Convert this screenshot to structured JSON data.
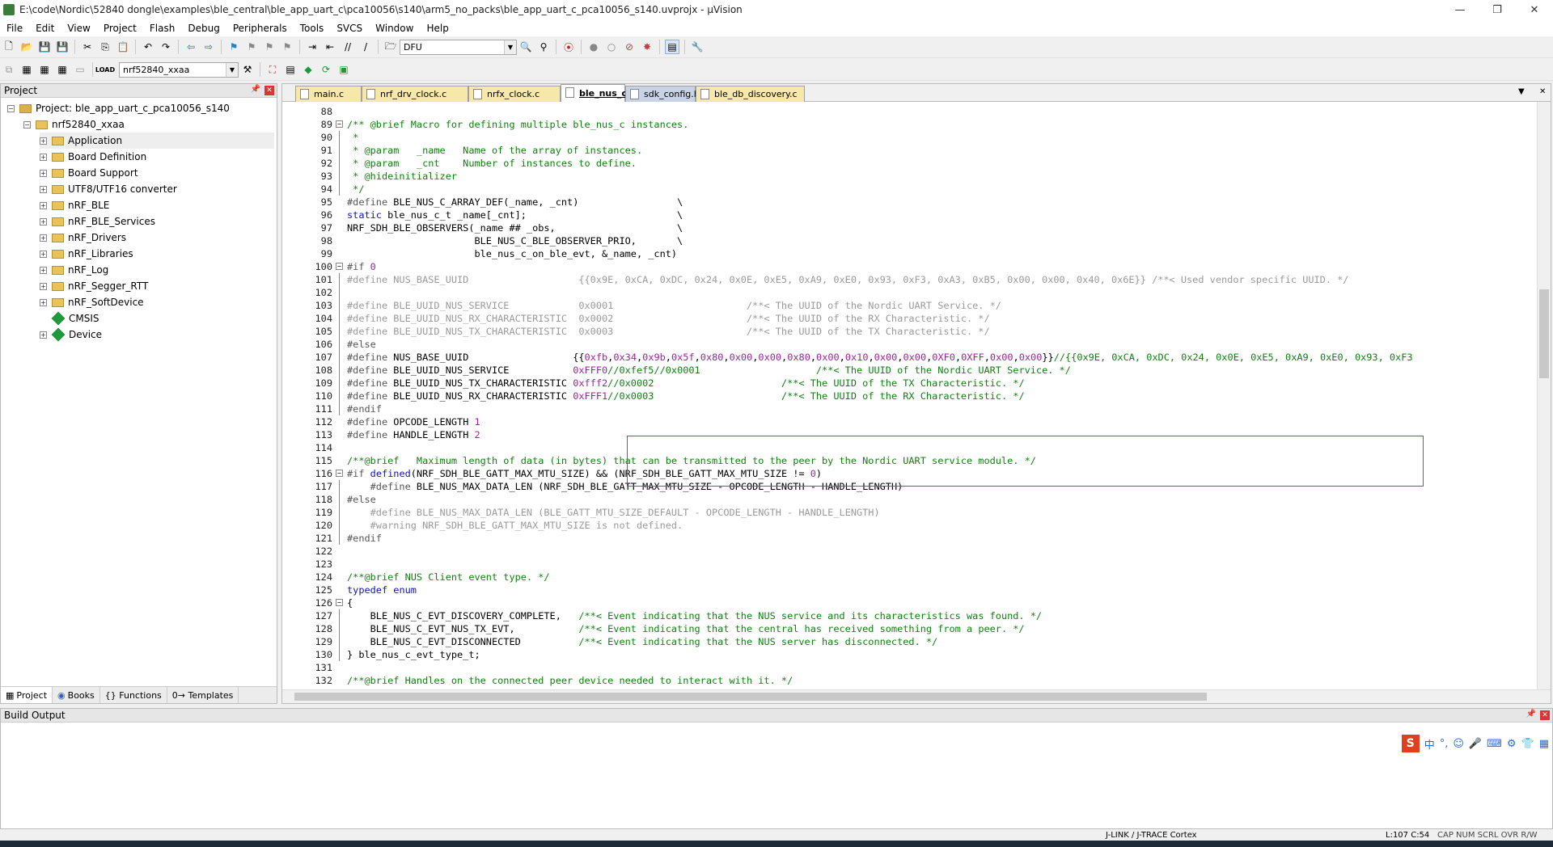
{
  "window": {
    "title": "E:\\code\\Nordic\\52840 dongle\\examples\\ble_central\\ble_app_uart_c\\pca10056\\s140\\arm5_no_packs\\ble_app_uart_c_pca10056_s140.uvprojx - µVision",
    "controls": [
      "—",
      "❐",
      "✕"
    ]
  },
  "menu": [
    "File",
    "Edit",
    "View",
    "Project",
    "Flash",
    "Debug",
    "Peripherals",
    "Tools",
    "SVCS",
    "Window",
    "Help"
  ],
  "toolbar": {
    "find_combo": "DFU",
    "target_combo": "nrf52840_xxaa"
  },
  "project_pane": {
    "title": "Project",
    "root": "Project: ble_app_uart_c_pca10056_s140",
    "target": "nrf52840_xxaa",
    "groups": [
      "Application",
      "Board Definition",
      "Board Support",
      "UTF8/UTF16 converter",
      "nRF_BLE",
      "nRF_BLE_Services",
      "nRF_Drivers",
      "nRF_Libraries",
      "nRF_Log",
      "nRF_Segger_RTT",
      "nRF_SoftDevice",
      "CMSIS",
      "Device"
    ],
    "tabs": [
      "Project",
      "Books",
      "{} Functions",
      "0→ Templates"
    ]
  },
  "editor": {
    "tabs": [
      "main.c",
      "nrf_drv_clock.c",
      "nrfx_clock.c",
      "ble_nus_c.h",
      "sdk_config.h",
      "ble_db_discovery.c"
    ],
    "active_tab": "ble_nus_c.h",
    "lines": [
      {
        "n": "88",
        "t": ""
      },
      {
        "n": "89",
        "t": "/** @brief Macro for defining multiple ble_nus_c instances."
      },
      {
        "n": "90",
        "t": " *"
      },
      {
        "n": "91",
        "t": " * @param   _name   Name of the array of instances."
      },
      {
        "n": "92",
        "t": " * @param   _cnt    Number of instances to define."
      },
      {
        "n": "93",
        "t": " * @hideinitializer"
      },
      {
        "n": "94",
        "t": " */"
      },
      {
        "n": "95",
        "t": "#define BLE_NUS_C_ARRAY_DEF(_name, _cnt)                 \\"
      },
      {
        "n": "96",
        "t": "static ble_nus_c_t _name[_cnt];                          \\"
      },
      {
        "n": "97",
        "t": "NRF_SDH_BLE_OBSERVERS(_name ## _obs,                     \\"
      },
      {
        "n": "98",
        "t": "                      BLE_NUS_C_BLE_OBSERVER_PRIO,       \\"
      },
      {
        "n": "99",
        "t": "                      ble_nus_c_on_ble_evt, &_name, _cnt)"
      },
      {
        "n": "100",
        "t": "#if 0"
      },
      {
        "n": "101",
        "t": "#define NUS_BASE_UUID                   {{0x9E, 0xCA, 0xDC, 0x24, 0x0E, 0xE5, 0xA9, 0xE0, 0x93, 0xF3, 0xA3, 0xB5, 0x00, 0x00, 0x40, 0x6E}} /**< Used vendor specific UUID. */"
      },
      {
        "n": "102",
        "t": ""
      },
      {
        "n": "103",
        "t": "#define BLE_UUID_NUS_SERVICE            0x0001                       /**< The UUID of the Nordic UART Service. */"
      },
      {
        "n": "104",
        "t": "#define BLE_UUID_NUS_RX_CHARACTERISTIC  0x0002                       /**< The UUID of the RX Characteristic. */"
      },
      {
        "n": "105",
        "t": "#define BLE_UUID_NUS_TX_CHARACTERISTIC  0x0003                       /**< The UUID of the TX Characteristic. */"
      },
      {
        "n": "106",
        "t": "#else"
      },
      {
        "n": "107",
        "t": "#define NUS_BASE_UUID                  {{0xfb,0x34,0x9b,0x5f,0x80,0x00,0x00,0x80,0x00,0x10,0x00,0x00,0XF0,0XFF,0x00,0x00}}//{{0x9E, 0xCA, 0xDC, 0x24, 0x0E, 0xE5, 0xA9, 0xE0, 0x93, 0xF3"
      },
      {
        "n": "108",
        "t": "#define BLE_UUID_NUS_SERVICE           0xFFF0//0xfef5//0x0001                    /**< The UUID of the Nordic UART Service. */"
      },
      {
        "n": "109",
        "t": "#define BLE_UUID_NUS_TX_CHARACTERISTIC 0xfff2//0x0002                      /**< The UUID of the TX Characteristic. */"
      },
      {
        "n": "110",
        "t": "#define BLE_UUID_NUS_RX_CHARACTERISTIC 0xFFF1//0x0003                      /**< The UUID of the RX Characteristic. */"
      },
      {
        "n": "111",
        "t": "#endif"
      },
      {
        "n": "112",
        "t": "#define OPCODE_LENGTH 1"
      },
      {
        "n": "113",
        "t": "#define HANDLE_LENGTH 2"
      },
      {
        "n": "114",
        "t": ""
      },
      {
        "n": "115",
        "t": "/**@brief   Maximum length of data (in bytes) that can be transmitted to the peer by the Nordic UART service module. */"
      },
      {
        "n": "116",
        "t": "#if defined(NRF_SDH_BLE_GATT_MAX_MTU_SIZE) && (NRF_SDH_BLE_GATT_MAX_MTU_SIZE != 0)"
      },
      {
        "n": "117",
        "t": "    #define BLE_NUS_MAX_DATA_LEN (NRF_SDH_BLE_GATT_MAX_MTU_SIZE - OPCODE_LENGTH - HANDLE_LENGTH)"
      },
      {
        "n": "118",
        "t": "#else"
      },
      {
        "n": "119",
        "t": "    #define BLE_NUS_MAX_DATA_LEN (BLE_GATT_MTU_SIZE_DEFAULT - OPCODE_LENGTH - HANDLE_LENGTH)"
      },
      {
        "n": "120",
        "t": "    #warning NRF_SDH_BLE_GATT_MAX_MTU_SIZE is not defined."
      },
      {
        "n": "121",
        "t": "#endif"
      },
      {
        "n": "122",
        "t": ""
      },
      {
        "n": "123",
        "t": ""
      },
      {
        "n": "124",
        "t": "/**@brief NUS Client event type. */"
      },
      {
        "n": "125",
        "t": "typedef enum"
      },
      {
        "n": "126",
        "t": "{"
      },
      {
        "n": "127",
        "t": "    BLE_NUS_C_EVT_DISCOVERY_COMPLETE,   /**< Event indicating that the NUS service and its characteristics was found. */"
      },
      {
        "n": "128",
        "t": "    BLE_NUS_C_EVT_NUS_TX_EVT,           /**< Event indicating that the central has received something from a peer. */"
      },
      {
        "n": "129",
        "t": "    BLE_NUS_C_EVT_DISCONNECTED          /**< Event indicating that the NUS server has disconnected. */"
      },
      {
        "n": "130",
        "t": "} ble_nus_c_evt_type_t;"
      },
      {
        "n": "131",
        "t": ""
      },
      {
        "n": "132",
        "t": "/**@brief Handles on the connected peer device needed to interact with it. */"
      }
    ]
  },
  "build_output": {
    "title": "Build Output"
  },
  "statusbar": {
    "debugger": "J-LINK / J-TRACE Cortex",
    "position": "L:107 C:54",
    "flags": "CAP  NUM  SCRL  OVR  R/W"
  },
  "ime": {
    "logo": "S",
    "mode": "中"
  }
}
